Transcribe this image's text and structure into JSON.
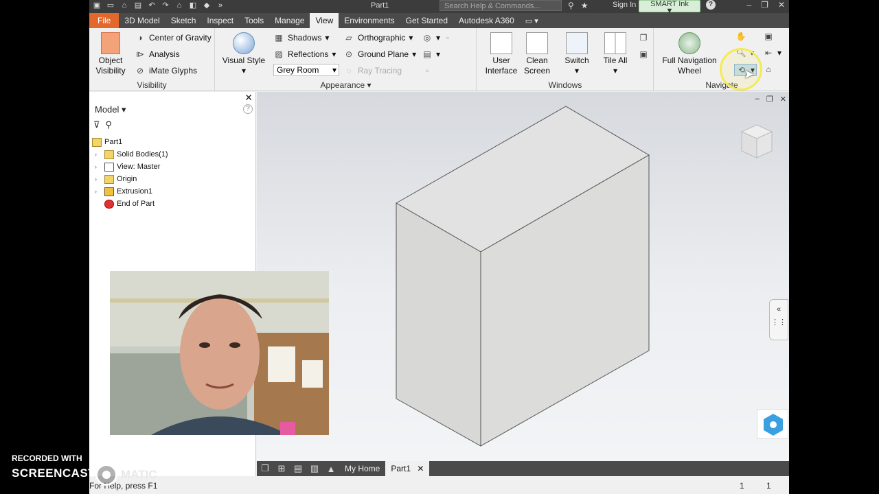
{
  "window": {
    "document_title": "Part1",
    "search_placeholder": "Search Help & Commands...",
    "sign_in": "Sign In",
    "smart_ink": "SMART Ink"
  },
  "tabs": [
    "File",
    "3D Model",
    "Sketch",
    "Inspect",
    "Tools",
    "Manage",
    "View",
    "Environments",
    "Get Started",
    "Autodesk A360"
  ],
  "active_tab": "View",
  "ribbon": {
    "visibility": {
      "title": "Visibility",
      "object_visibility": "Object\nVisibility",
      "center_of_gravity": "Center of Gravity",
      "analysis": "Analysis",
      "imate_glyphs": "iMate Glyphs"
    },
    "appearance": {
      "title": "Appearance",
      "visual_style": "Visual Style",
      "shadows": "Shadows",
      "reflections": "Reflections",
      "grey_room": "Grey Room",
      "orthographic": "Orthographic",
      "ground_plane": "Ground Plane",
      "ray_tracing": "Ray Tracing"
    },
    "windows": {
      "title": "Windows",
      "user_interface": "User\nInterface",
      "clean_screen": "Clean\nScreen",
      "switch": "Switch",
      "tile_all": "Tile All"
    },
    "navigate": {
      "title": "Navigate",
      "full_navigation_wheel": "Full Navigation\nWheel"
    }
  },
  "browser": {
    "header": "Model",
    "tree": [
      {
        "label": "Part1",
        "icon": "part-icon",
        "expandable": false
      },
      {
        "label": "Solid Bodies(1)",
        "icon": "folder-icon",
        "expandable": true
      },
      {
        "label": "View: Master",
        "icon": "view-icon",
        "expandable": true
      },
      {
        "label": "Origin",
        "icon": "folder-icon",
        "expandable": true
      },
      {
        "label": "Extrusion1",
        "icon": "extrusion-icon",
        "expandable": true
      },
      {
        "label": "End of Part",
        "icon": "end-of-part-icon",
        "expandable": false
      }
    ]
  },
  "doc_tabs": {
    "my_home": "My Home",
    "part1": "Part1"
  },
  "status": {
    "help_text": "For Help, press F1",
    "n1": "1",
    "n2": "1"
  },
  "watermark": {
    "line1": "RECORDED WITH",
    "line2": "SCREENCAST",
    "line3": "MATIC"
  },
  "colors": {
    "file_tab": "#e4682c",
    "title_bar": "#3c3c3c",
    "highlight": "#f4ea55"
  }
}
